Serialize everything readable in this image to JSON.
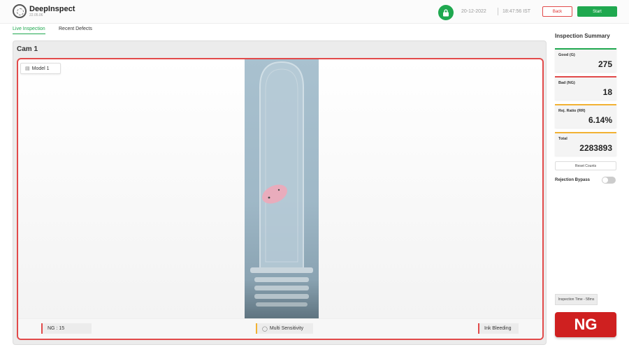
{
  "header": {
    "logo_name": "DeepInspect",
    "logo_version": "22.05.06",
    "date": "20-12-2022",
    "time": "18:47:56 IST",
    "back_label": "Back",
    "start_label": "Start",
    "lock_icon": "lock-icon",
    "accent_green": "#1fa84f",
    "accent_red": "#e24a4a"
  },
  "tabs": [
    {
      "label": "Live Inspection",
      "active": true
    },
    {
      "label": "Recent Defects",
      "active": false
    }
  ],
  "camera": {
    "title": "Cam 1",
    "model_label": "Model 1",
    "footer": {
      "ng_count": "NG : 15",
      "sensitivity": "Multi Sensitivity",
      "defect_type": "Ink Bleeding"
    }
  },
  "summary": {
    "title": "Inspection Summary",
    "cards": [
      {
        "label": "Good (G)",
        "value": "275",
        "color": "#1fa84f"
      },
      {
        "label": "Bad (NG)",
        "value": "18",
        "color": "#e24a4a"
      },
      {
        "label": "Rej. Ratio (RR)",
        "value": "6.14%",
        "color": "#f2b233"
      },
      {
        "label": "Total",
        "value": "2283893",
        "color": "#f2b233"
      }
    ],
    "reset_label": "Reset Counts",
    "bypass_label": "Rejection Bypass",
    "bypass_on": false,
    "inspection_time": "Inspection Time - 58ms",
    "result": "NG"
  }
}
